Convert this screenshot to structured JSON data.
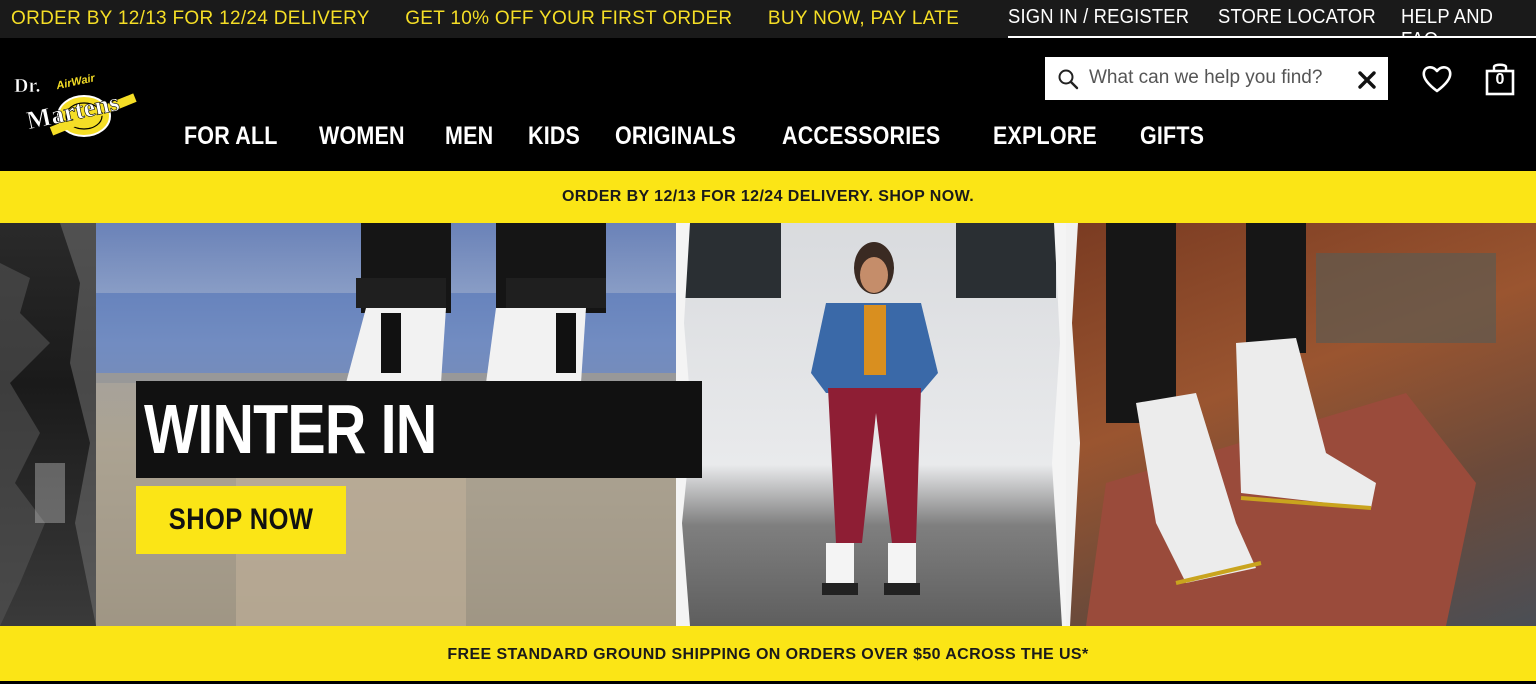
{
  "promo_ticker": [
    "ORDER BY 12/13 FOR 12/24 DELIVERY",
    "GET 10% OFF YOUR FIRST ORDER",
    "BUY NOW, PAY LATER WITH"
  ],
  "utility_nav": {
    "sign_in": "SIGN IN / REGISTER",
    "store_locator": "STORE LOCATOR",
    "help": "HELP AND FAQ"
  },
  "logo": {
    "line1": "Dr.",
    "line2": "Martens",
    "tag": "AirWair"
  },
  "main_nav": [
    "FOR ALL",
    "WOMEN",
    "MEN",
    "KIDS",
    "ORIGINALS",
    "ACCESSORIES",
    "EXPLORE",
    "GIFTS"
  ],
  "search": {
    "placeholder": "What can we help you find?",
    "value": ""
  },
  "bag": {
    "count": "0"
  },
  "banner_top": "ORDER BY 12/13 FOR 12/24 DELIVERY. SHOP NOW.",
  "hero": {
    "title": "WINTER IN WHITE.",
    "cta": "SHOP NOW"
  },
  "banner_bottom": "FREE STANDARD GROUND SHIPPING ON ORDERS OVER $50 ACROSS THE US*",
  "colors": {
    "brand_yellow": "#fbe516",
    "ticker_yellow": "#f5de26",
    "black": "#000000"
  },
  "icons": [
    "search-icon",
    "clear-icon",
    "heart-icon",
    "shopping-bag-icon"
  ]
}
